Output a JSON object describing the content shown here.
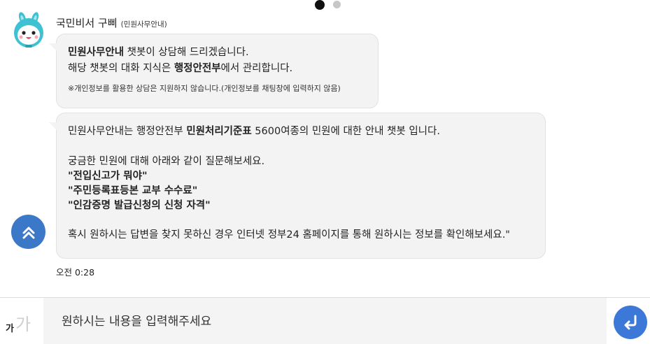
{
  "pager": {
    "count": 2,
    "active": 1
  },
  "bot": {
    "name": "국민비서 구삐",
    "subtitle": "(민원사무안내)"
  },
  "message1": {
    "line1_bold": "민원사무안내",
    "line1_rest": " 챗봇이 상담해 드리겠습니다.",
    "line2_pre": "해당 챗봇의 대화 지식은 ",
    "line2_bold": "행정안전부",
    "line2_post": "에서 관리합니다.",
    "note": "※개인정보를 활용한 상담은 지원하지 않습니다.(개인정보를 채팅창에 입력하지 않음)"
  },
  "message2": {
    "intro_pre": "민원사무안내는 행정안전부 ",
    "intro_bold": "민원처리기준표",
    "intro_post": " 5600여종의 민원에 대한 안내 챗봇 입니다.",
    "prompt": "궁금한 민원에 대해 아래와 같이 질문해보세요.",
    "examples": [
      "\"전입신고가 뭐야\"",
      "\"주민등록표등본 교부 수수료\"",
      "\"인감증명 발급신청의 신청 자격\""
    ],
    "closing": "혹시 원하시는 답변을 찾지 못하신 경우 인터넷 정부24 홈페이지를 통해 원하시는 정보를 확인해보세요.\""
  },
  "timestamp": "오전 0:28",
  "input": {
    "placeholder": "원하시는 내용을 입력해주세요",
    "font_small": "가",
    "font_large": "가"
  },
  "icons": {
    "scroll_top": "double-chevron-up-icon",
    "send": "enter-arrow-icon",
    "avatar": "rabbit-mascot-icon"
  },
  "colors": {
    "accent": "#3b78d8",
    "bubble": "#f3f3f3",
    "mascot": "#3ec1d3"
  }
}
